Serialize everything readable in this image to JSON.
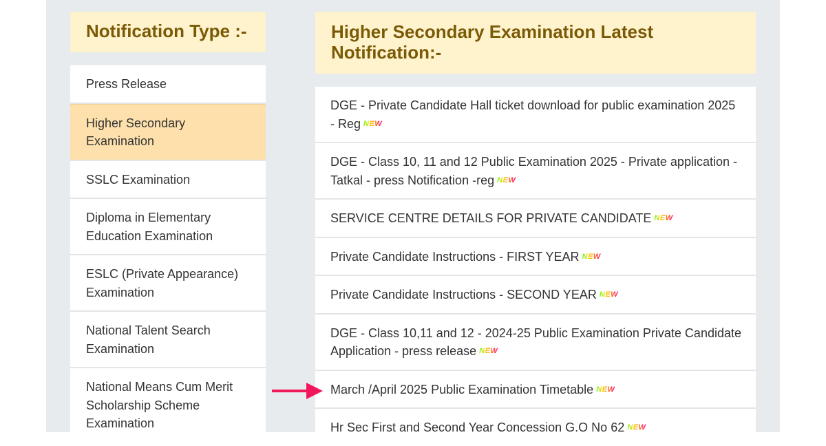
{
  "sidebar": {
    "title": "Notification Type :-",
    "items": [
      {
        "label": "Press Release",
        "active": false
      },
      {
        "label": "Higher Secondary Examination",
        "active": true
      },
      {
        "label": "SSLC Examination",
        "active": false
      },
      {
        "label": "Diploma in Elementary Education Examination",
        "active": false
      },
      {
        "label": "ESLC (Private Appearance) Examination",
        "active": false
      },
      {
        "label": "National Talent Search Examination",
        "active": false
      },
      {
        "label": "National Means Cum Merit Scholarship Scheme Examination",
        "active": false
      }
    ]
  },
  "main": {
    "title": "Higher Secondary Examination Latest Notification:-",
    "new_badge": "NEW",
    "notifications": [
      {
        "label": "DGE - Private Candidate Hall ticket download for public examination 2025 - Reg"
      },
      {
        "label": "DGE - Class 10, 11 and 12 Public Examination 2025 - Private application - Tatkal - press Notification -reg"
      },
      {
        "label": "SERVICE CENTRE DETAILS FOR PRIVATE CANDIDATE"
      },
      {
        "label": "Private Candidate Instructions - FIRST YEAR"
      },
      {
        "label": "Private Candidate Instructions - SECOND YEAR"
      },
      {
        "label": "DGE - Class 10,11 and 12 - 2024-25 Public Examination Private Candidate Application - press release"
      },
      {
        "label": "March /April 2025 Public Examination Timetable"
      },
      {
        "label": "Hr Sec First and Second Year Concession G.O No 62"
      }
    ]
  },
  "annotation": {
    "arrow_color": "#f0175a",
    "points_to": "March /April 2025 Public Examination Timetable"
  }
}
